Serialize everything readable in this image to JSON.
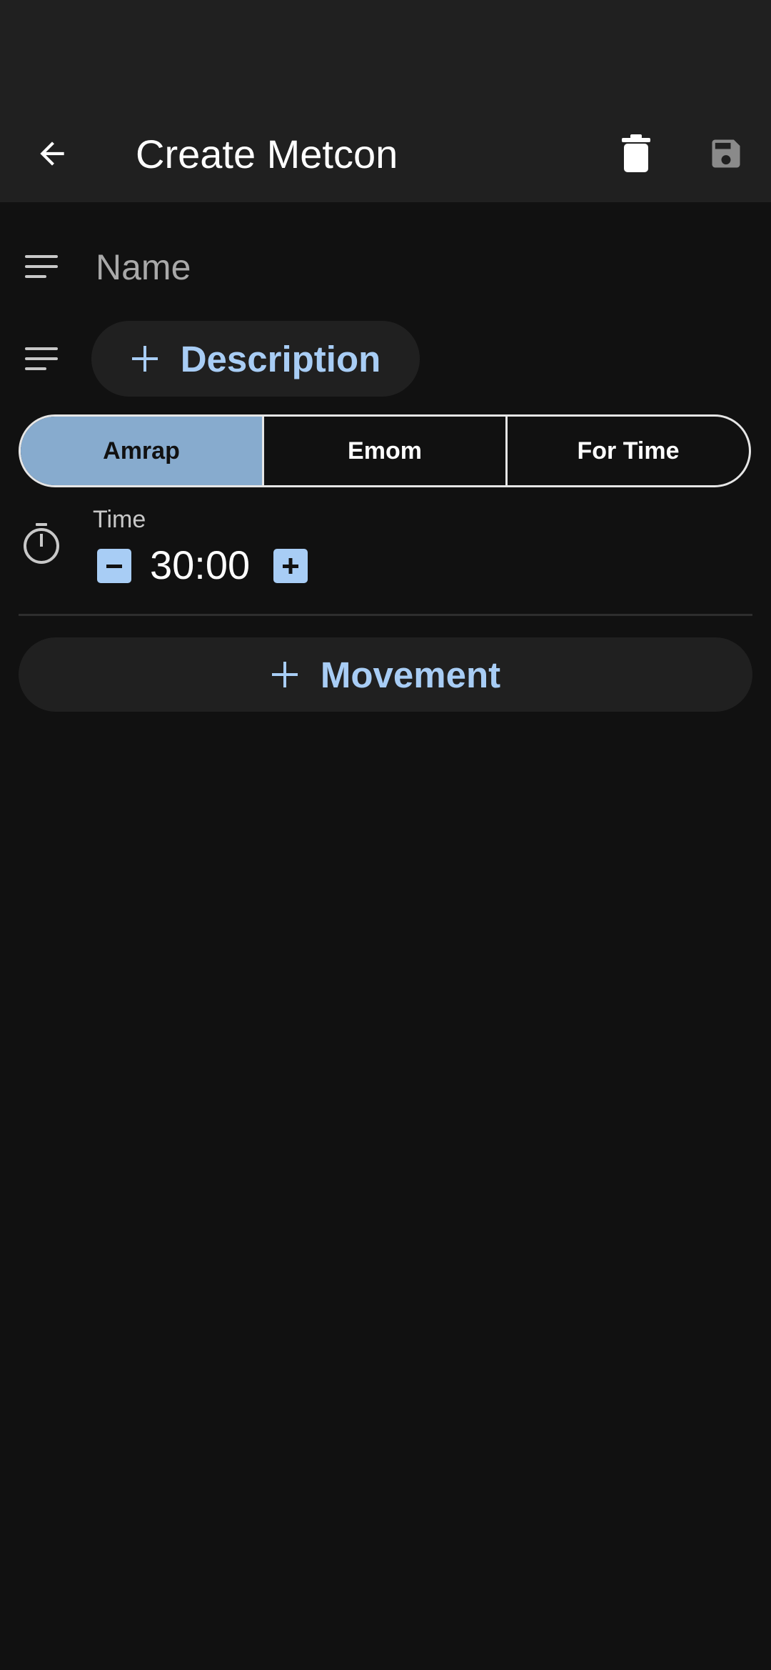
{
  "app_bar": {
    "title": "Create Metcon",
    "back_icon": "arrow-back-icon",
    "delete_icon": "trash-icon",
    "save_icon": "floppy-disk-icon"
  },
  "form": {
    "name": {
      "icon": "notes-icon",
      "value": "",
      "placeholder": "Name"
    },
    "description": {
      "icon": "notes-icon",
      "button_label": "Description"
    },
    "type_selector": {
      "options": [
        "Amrap",
        "Emom",
        "For Time"
      ],
      "selected": "Amrap"
    },
    "time": {
      "icon": "stopwatch-icon",
      "label": "Time",
      "value": "30:00"
    },
    "add_movement_label": "Movement"
  },
  "colors": {
    "background": "#111111",
    "app_bar": "#202020",
    "accent": "#a8cdf5",
    "selected_segment": "#87abce"
  }
}
